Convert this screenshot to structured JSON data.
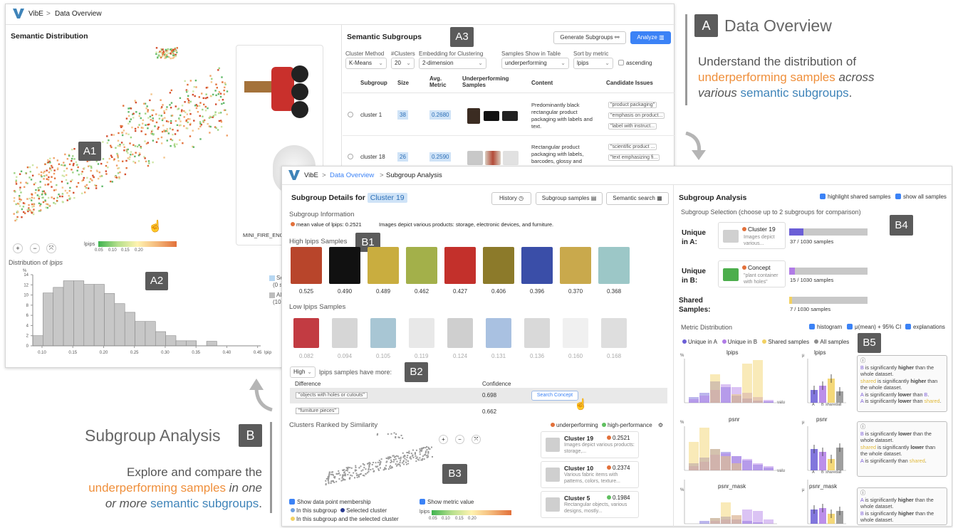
{
  "colors": {
    "accent": "#3b82f6",
    "orange": "#ef8f3b",
    "blue": "#3f84b9",
    "tag": "#5b5b5b",
    "unique_a": "#6b5ed6",
    "unique_b": "#b07be6",
    "shared": "#f2d162",
    "all": "#8e8e8e",
    "high": "#e2703a",
    "low": "#5fbf5f"
  },
  "top": {
    "app": "VibE",
    "crumb": "Data Overview",
    "sem_dist_title": "Semantic Distribution",
    "tag_a1": "A1",
    "tag_a2": "A2",
    "tag_a3": "A3",
    "legend_label": "lpips",
    "legend_ticks": [
      "0.05",
      "0.10",
      "0.15",
      "0.20"
    ],
    "preview_caption": "MINI_FIRE_ENG",
    "dist_title_prefix": "Distribution of ",
    "dist_title_metric": "lpips",
    "dist_ylabel": "%",
    "dist_xlabel": "lpips",
    "dist_legend": [
      "Se",
      "(0 s",
      "All",
      "(100"
    ],
    "subgroups_title": "Semantic Subgroups",
    "generate_btn": "Generate Subgroups",
    "analyze_btn": "Analyze",
    "ctrl_labels": [
      "Cluster Method",
      "#Clusters",
      "Embedding for Clustering",
      "Samples Show in Table",
      "Sort by metric"
    ],
    "ctrl_values": [
      "K-Means",
      "20",
      "2-dimension",
      "underperforming",
      "lpips"
    ],
    "ascending": "ascending",
    "table_headers": [
      "Subgroup",
      "Size",
      "Avg. Metric",
      "Underperforming Samples",
      "Content",
      "Candidate Issues"
    ],
    "rows": [
      {
        "name": "cluster 1",
        "size": "38",
        "metric": "0.2680",
        "content": "Predominantly black rectangular product packaging with labels and text.",
        "issues": [
          "\"product packaging\"",
          "\"emphasis on product...",
          "\"label with instruct..."
        ]
      },
      {
        "name": "cluster 18",
        "size": "26",
        "metric": "0.2590",
        "content": "Rectangular product packaging with labels, barcodes, glossy and",
        "issues": [
          "\"scientific product ...",
          "\"text emphasizing fi...",
          "\"product features de..."
        ]
      }
    ]
  },
  "chart_data": {
    "type": "bar",
    "title": "Distribution of lpips",
    "xlabel": "lpips",
    "ylabel": "%",
    "x_ticks": [
      "0.10",
      "0.15",
      "0.20",
      "0.25",
      "0.30",
      "0.35",
      "0.40",
      "0.45"
    ],
    "y_ticks": [
      "0",
      "2",
      "4",
      "6",
      "8",
      "10",
      "12",
      "14"
    ],
    "ylim": [
      0,
      14
    ],
    "bin_start": 0.085,
    "bin_width": 0.0166,
    "values": [
      2,
      10.4,
      11.5,
      12.8,
      12.8,
      12.1,
      12.1,
      10.3,
      8.3,
      6.6,
      4.8,
      4.8,
      2.8,
      2.0,
      1.0,
      1.0,
      0,
      0.9,
      0,
      0
    ]
  },
  "side_a": {
    "tag": "A",
    "title": "Data Overview",
    "desc_1": "Understand the distribution of",
    "desc_2": "underperforming samples",
    "desc_3": " across",
    "desc_4": "various ",
    "desc_5": "semantic subgroups",
    "desc_6": "."
  },
  "side_b": {
    "tag": "B",
    "title": "Subgroup Analysis",
    "desc_1": "Explore and compare the",
    "desc_2": "underperforming samples",
    "desc_3": " in one",
    "desc_4": "or more ",
    "desc_5": "semantic subgroups",
    "desc_6": "."
  },
  "detail": {
    "app": "VibE",
    "crumb1": "Data Overview",
    "crumb2": "Subgroup Analysis",
    "title_prefix": "Subgroup Details for",
    "cluster": "Cluster 19",
    "history": "History",
    "samples_btn": "Subgroup samples",
    "search_btn": "Semantic search",
    "info_title": "Subgroup Information",
    "info_mean": "mean value of lpips: 0.2521",
    "info_desc": "Images depict various products: storage, electronic devices, and furniture.",
    "high_title": "High lpips Samples",
    "high_values": [
      "0.525",
      "0.490",
      "0.489",
      "0.462",
      "0.427",
      "0.406",
      "0.396",
      "0.370",
      "0.368"
    ],
    "low_title": "Low lpips Samples",
    "low_values": [
      "0.082",
      "0.094",
      "0.105",
      "0.119",
      "0.124",
      "0.131",
      "0.136",
      "0.160",
      "0.168"
    ],
    "high_sel": "High",
    "have_more": "lpips samples have more:",
    "diff_head": "Difference",
    "conf_head": "Confidence",
    "diffs": [
      {
        "text": "\"objects with holes or cutouts\"",
        "conf": "0.698"
      },
      {
        "text": "\"furniture pieces\"",
        "conf": "0.662"
      }
    ],
    "search_concept": "Search Concept",
    "ranked_title": "Clusters Ranked by Similarity",
    "legend_under": "underperforming",
    "legend_high": "high-performance",
    "ranked": [
      {
        "name": "Cluster 19",
        "value": "0.2521",
        "desc": "Images depict various products: storage,..."
      },
      {
        "name": "Cluster 10",
        "value": "0.2374",
        "desc": "Various fabric items with patterns, colors, texture..."
      },
      {
        "name": "Cluster 5",
        "value": "0.1984",
        "desc": "Rectangular objects, various designs, mostly..."
      }
    ],
    "show_membership": "Show data point membership",
    "in_subgroup": "In this subgroup",
    "selected_cluster": "Selected cluster",
    "in_both": "In this subgroup and the selected cluster",
    "show_metric": "Show metric value",
    "metric_legend": "lpips",
    "metric_ticks": [
      "0.05",
      "0.10",
      "0.15",
      "0.20"
    ],
    "tag_b1": "B1",
    "tag_b2": "B2",
    "tag_b3": "B3"
  },
  "analysis": {
    "title": "Subgroup Analysis",
    "highlight": "highlight shared samples",
    "show_all": "show all samples",
    "selection": "Subgroup Selection (choose up to 2 subgroups for comparison)",
    "unique_a": "Unique in A:",
    "unique_b": "Unique in B:",
    "shared": "Shared Samples:",
    "a_name": "Cluster 19",
    "a_desc": "Images depict various...",
    "a_count": "37 / 1030 samples",
    "a_frac": 0.036,
    "b_name": "Concept",
    "b_desc": "\"plant container with holes\"",
    "b_count": "15 / 1030 samples",
    "b_frac": 0.015,
    "shared_count": "7 / 1030 samples",
    "shared_frac": 0.007,
    "metric_dist": "Metric Distribution",
    "histogram": "histogram",
    "mean_ci": "μ(mean) + 95% CI",
    "explanations": "explanations",
    "legend": [
      "Unique in A",
      "Unique in B",
      "Shared samples",
      "All samples"
    ],
    "metrics": [
      "lpips",
      "psnr",
      "psnr_mask"
    ],
    "mu": "μ",
    "pct": "%",
    "valu": "valu",
    "bar_ticks": [
      "A",
      "B",
      "shared",
      "all"
    ],
    "tag_b4": "B4",
    "tag_b5": "B5"
  }
}
